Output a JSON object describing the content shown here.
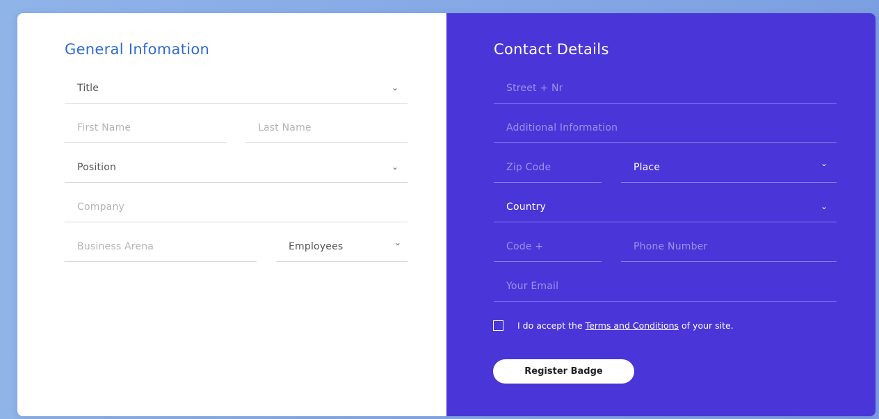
{
  "general": {
    "heading": "General Infomation",
    "title": {
      "value": "Title"
    },
    "first_name": {
      "placeholder": "First Name"
    },
    "last_name": {
      "placeholder": "Last Name"
    },
    "position": {
      "value": "Position"
    },
    "company": {
      "placeholder": "Company"
    },
    "business_arena": {
      "placeholder": "Business Arena"
    },
    "employees": {
      "value": "Employees"
    }
  },
  "contact": {
    "heading": "Contact Details",
    "street": {
      "placeholder": "Street + Nr"
    },
    "additional": {
      "placeholder": "Additional Information"
    },
    "zip": {
      "placeholder": "Zip Code"
    },
    "place": {
      "value": "Place"
    },
    "country": {
      "value": "Country"
    },
    "code": {
      "placeholder": "Code +"
    },
    "phone": {
      "placeholder": "Phone Number"
    },
    "email": {
      "placeholder": "Your Email"
    },
    "terms": {
      "prefix": "I do accept the ",
      "link": "Terms and Conditions",
      "suffix": " of your site."
    },
    "submit_label": "Register Badge"
  },
  "icons": {
    "dropdown": "chevron-down-icon",
    "checkbox": "checkbox-icon"
  },
  "colors": {
    "heading_blue": "#2f6bd2",
    "panel_purple": "#4a35d8",
    "white": "#ffffff"
  }
}
